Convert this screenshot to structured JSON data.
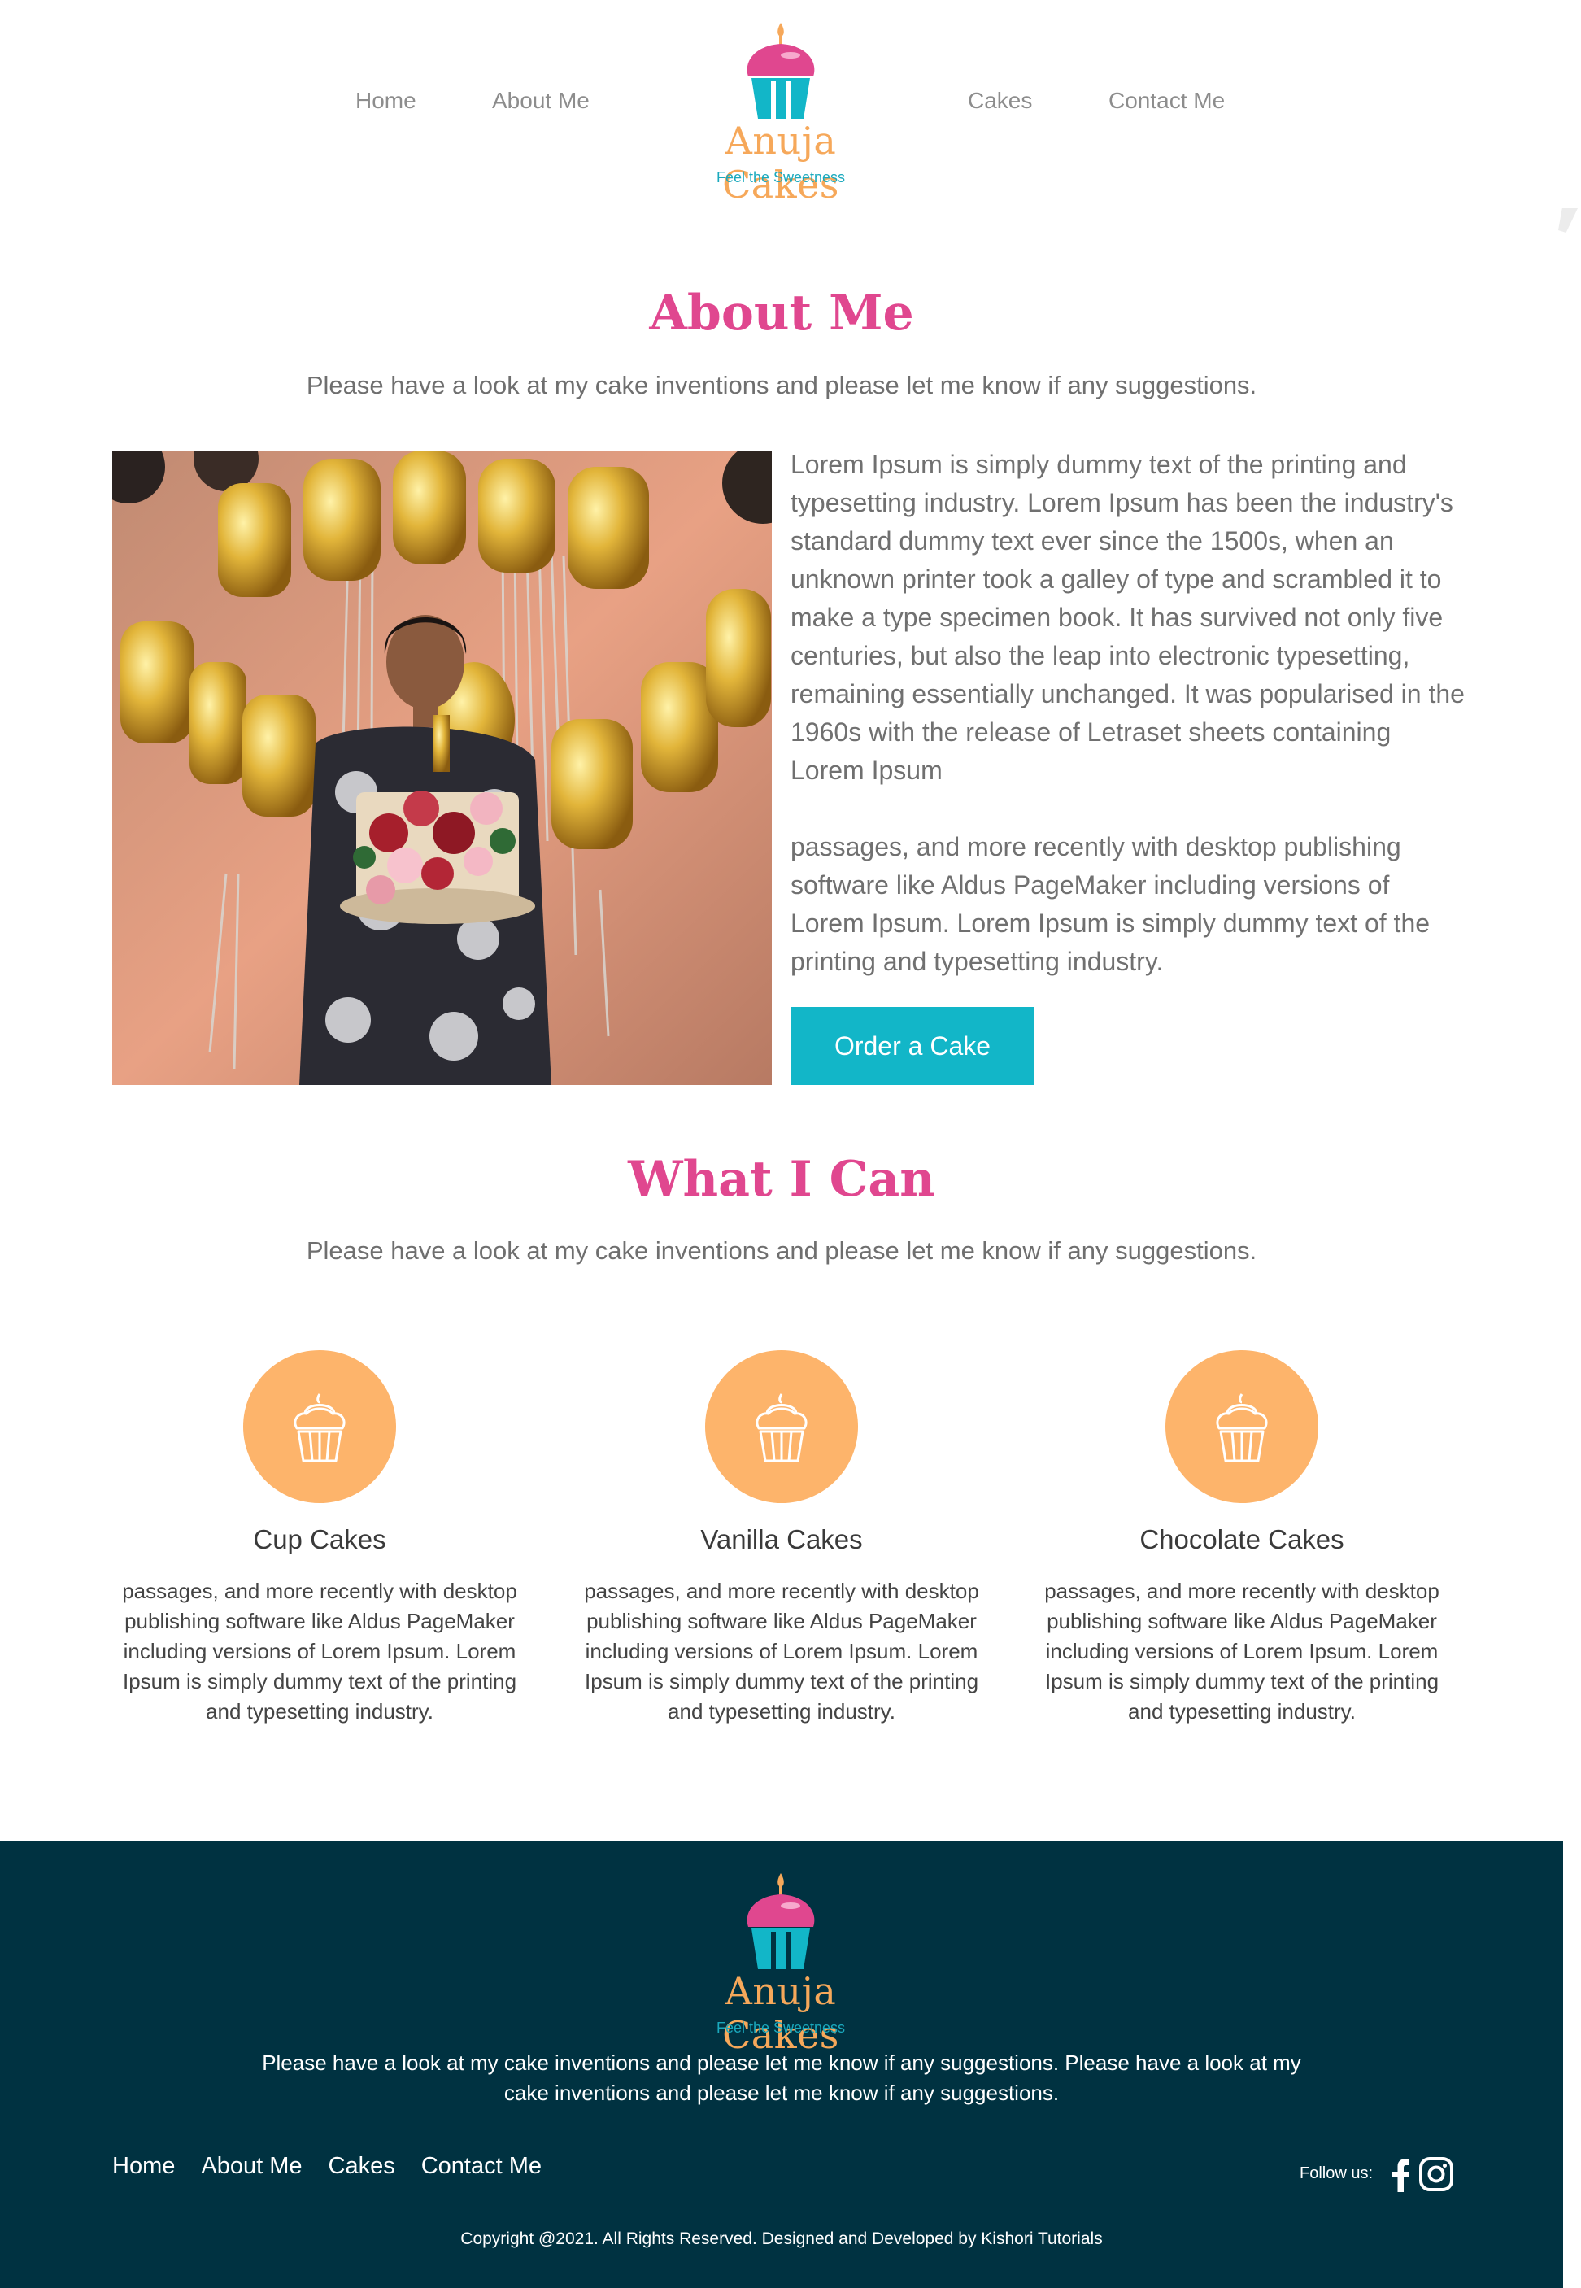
{
  "nav": {
    "left": [
      "Home",
      "About Me"
    ],
    "right": [
      "Cakes",
      "Contact Me"
    ]
  },
  "logo": {
    "brand": "Anuja Cakes",
    "tagline": "Feel the Sweetness",
    "icon": "cupcake-logo-icon"
  },
  "about": {
    "title": "About Me",
    "subtitle": "Please have a look at my cake inventions and please let me know if any suggestions.",
    "paragraph1": "Lorem Ipsum is simply dummy text of the printing and typesetting industry. Lorem Ipsum has been the industry's standard dummy text ever since the 1500s, when an unknown printer took a galley of type and scrambled it to make a type specimen book. It has survived not only five centuries, but also the leap into electronic typesetting, remaining essentially unchanged. It was popularised in the 1960s with the release of Letraset sheets containing Lorem Ipsum",
    "paragraph2": "passages, and more recently with desktop publishing software like Aldus PageMaker including versions of Lorem Ipsum. Lorem Ipsum is simply dummy text of the printing and typesetting industry.",
    "button": "Order a Cake"
  },
  "services": {
    "title": "What I Can",
    "subtitle": "Please have a look at my cake inventions and please let me know if any suggestions.",
    "items": [
      {
        "name": "Cup Cakes",
        "icon": "cupcake-icon",
        "desc": "passages, and more recently with desktop publishing software like Aldus PageMaker including versions of Lorem Ipsum. Lorem Ipsum is simply dummy text of the printing and typesetting industry."
      },
      {
        "name": "Vanilla Cakes",
        "icon": "cupcake-icon",
        "desc": "passages, and more recently with desktop publishing software like Aldus PageMaker including versions of Lorem Ipsum. Lorem Ipsum is simply dummy text of the printing and typesetting industry."
      },
      {
        "name": "Chocolate Cakes",
        "icon": "cupcake-icon",
        "desc": "passages, and more recently with desktop publishing software like Aldus PageMaker including versions of Lorem Ipsum. Lorem Ipsum is simply dummy text of the printing and typesetting industry."
      }
    ]
  },
  "footer": {
    "text": "Please have a look at my cake inventions and please let me know if any suggestions. Please have a look at my cake inventions and please let me know if any suggestions.",
    "nav": [
      "Home",
      "About Me",
      "Cakes",
      "Contact Me"
    ],
    "follow_label": "Follow us:",
    "social_icons": [
      "facebook-icon",
      "instagram-icon"
    ],
    "copyright": "Copyright @2021. All Rights Reserved. Designed and Developed by Kishori Tutorials"
  },
  "colors": {
    "accent_pink": "#e0478f",
    "accent_teal": "#12b6c8",
    "accent_orange": "#fdb46b",
    "footer_bg": "#003241"
  }
}
